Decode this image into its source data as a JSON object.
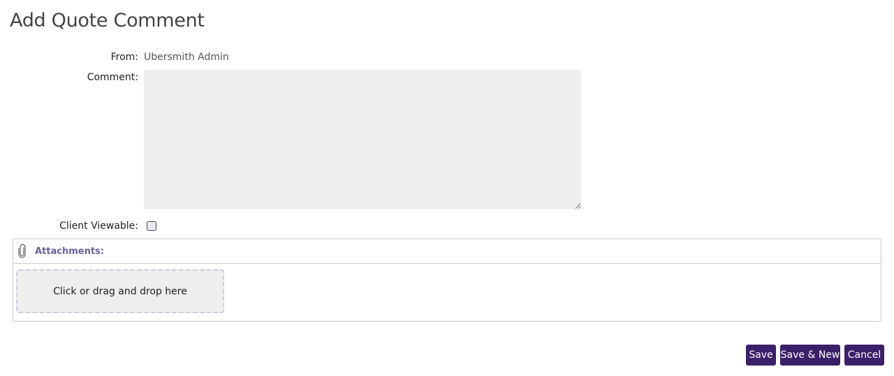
{
  "page": {
    "title": "Add Quote Comment"
  },
  "form": {
    "from_label": "From:",
    "from_value": "Ubersmith Admin",
    "comment_label": "Comment:",
    "comment_value": "",
    "client_viewable_label": "Client Viewable:",
    "client_viewable_checked": false
  },
  "attachments": {
    "title": "Attachments:",
    "icon": "paperclip-icon",
    "dropzone_text": "Click or drag and drop here"
  },
  "actions": {
    "save_label": "Save",
    "save_new_label": "Save & New",
    "cancel_label": "Cancel"
  },
  "colors": {
    "button_bg": "#3b2069",
    "attachments_title": "#6a5fa0",
    "dropzone_border": "#cfc9e6"
  }
}
